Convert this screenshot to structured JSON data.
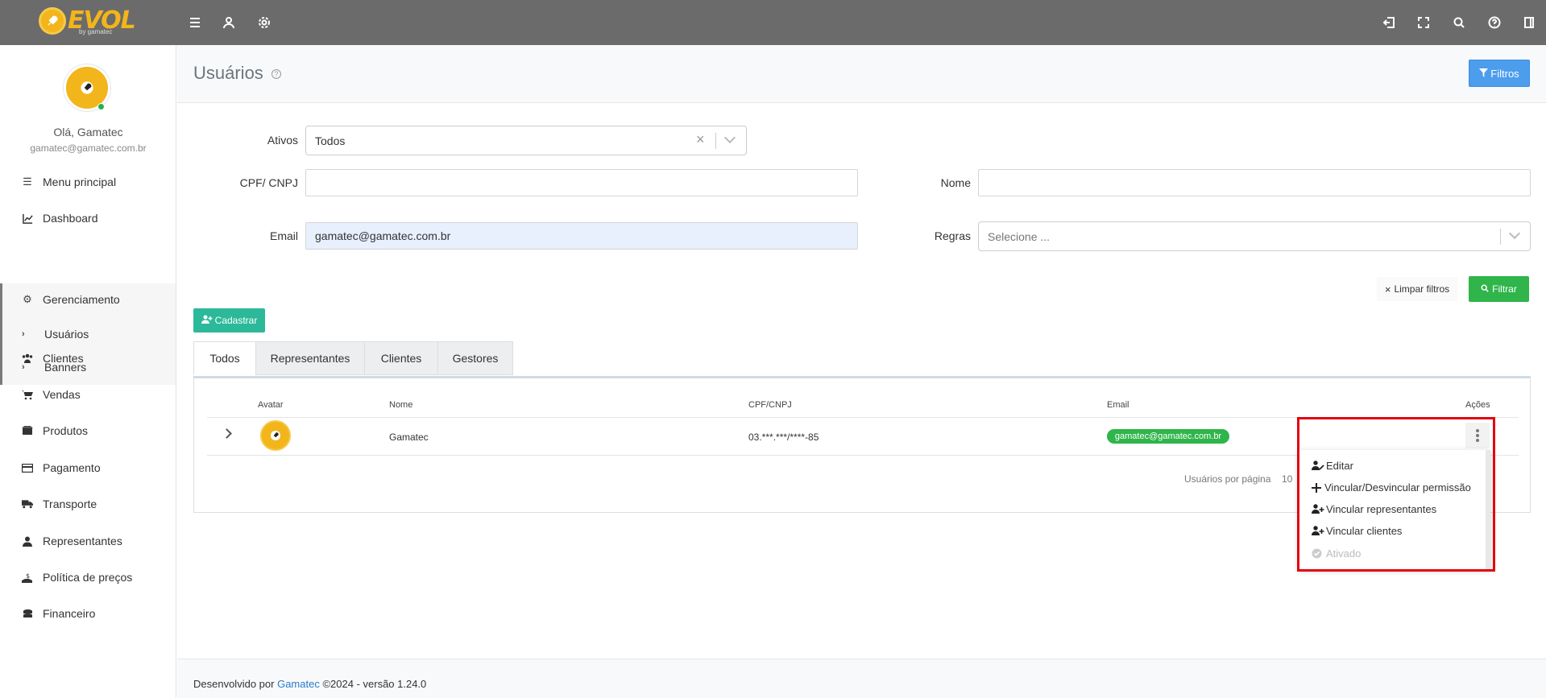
{
  "topbar": {
    "logo_text": "EVOL",
    "logo_sub": "by gamatec",
    "left_icons": [
      "menu-icon",
      "user-icon",
      "gear-icon"
    ],
    "right_icons": [
      "logout-icon",
      "fullscreen-icon",
      "search-icon",
      "help-icon",
      "panel-icon"
    ]
  },
  "sidebar": {
    "greeting": "Olá, Gamatec",
    "email": "gamatec@gamatec.com.br",
    "items": [
      {
        "label": "Menu principal",
        "icon": "list-icon"
      },
      {
        "label": "Dashboard",
        "icon": "chart-icon"
      },
      {
        "label": "Gerenciamento",
        "icon": "gear-icon"
      },
      {
        "label": "Clientes",
        "icon": "users-icon"
      },
      {
        "label": "Vendas",
        "icon": "cart-icon"
      },
      {
        "label": "Produtos",
        "icon": "box-icon"
      },
      {
        "label": "Pagamento",
        "icon": "card-icon"
      },
      {
        "label": "Transporte",
        "icon": "truck-icon"
      },
      {
        "label": "Representantes",
        "icon": "person-icon"
      },
      {
        "label": "Política de preços",
        "icon": "price-icon"
      },
      {
        "label": "Financeiro",
        "icon": "coins-icon"
      }
    ],
    "sub_items": [
      {
        "label": "Usuários"
      },
      {
        "label": "Banners"
      }
    ]
  },
  "header": {
    "title": "Usuários",
    "filtros_label": "Filtros"
  },
  "filters": {
    "ativos_label": "Ativos",
    "ativos_value": "Todos",
    "cpf_label": "CPF/ CNPJ",
    "cpf_value": "",
    "nome_label": "Nome",
    "nome_value": "",
    "email_label": "Email",
    "email_value": "gamatec@gamatec.com.br",
    "regras_label": "Regras",
    "regras_placeholder": "Selecione ...",
    "limpar_label": "Limpar filtros",
    "filtrar_label": "Filtrar"
  },
  "cadastrar_label": "Cadastrar",
  "tabs": [
    "Todos",
    "Representantes",
    "Clientes",
    "Gestores"
  ],
  "table": {
    "columns": [
      "Avatar",
      "Nome",
      "CPF/CNPJ",
      "Email",
      "Ações"
    ],
    "rows": [
      {
        "nome": "Gamatec",
        "cpf": "03.***.***/****-85",
        "email": "gamatec@gamatec.com.br"
      }
    ],
    "per_page_label": "Usuários por página",
    "per_page_value": "10"
  },
  "actions_menu": {
    "items": [
      {
        "label": "Editar",
        "icon": "user-edit-icon",
        "enabled": true
      },
      {
        "label": "Vincular/Desvincular permissão",
        "icon": "plus-icon",
        "enabled": true
      },
      {
        "label": "Vincular representantes",
        "icon": "user-plus-icon",
        "enabled": true
      },
      {
        "label": "Vincular clientes",
        "icon": "user-plus-icon",
        "enabled": true
      },
      {
        "label": "Ativado",
        "icon": "check-circle-icon",
        "enabled": false
      }
    ]
  },
  "footer": {
    "prefix": "Desenvolvido por",
    "link": "Gamatec",
    "suffix": "©2024 - versão 1.24.0"
  },
  "colors": {
    "topbar": "#6b6b6b",
    "brand": "#f2b51b",
    "primary": "#4d9ded",
    "success": "#2fb54a",
    "teal": "#2bb99a",
    "highlight": "#e3000f"
  }
}
